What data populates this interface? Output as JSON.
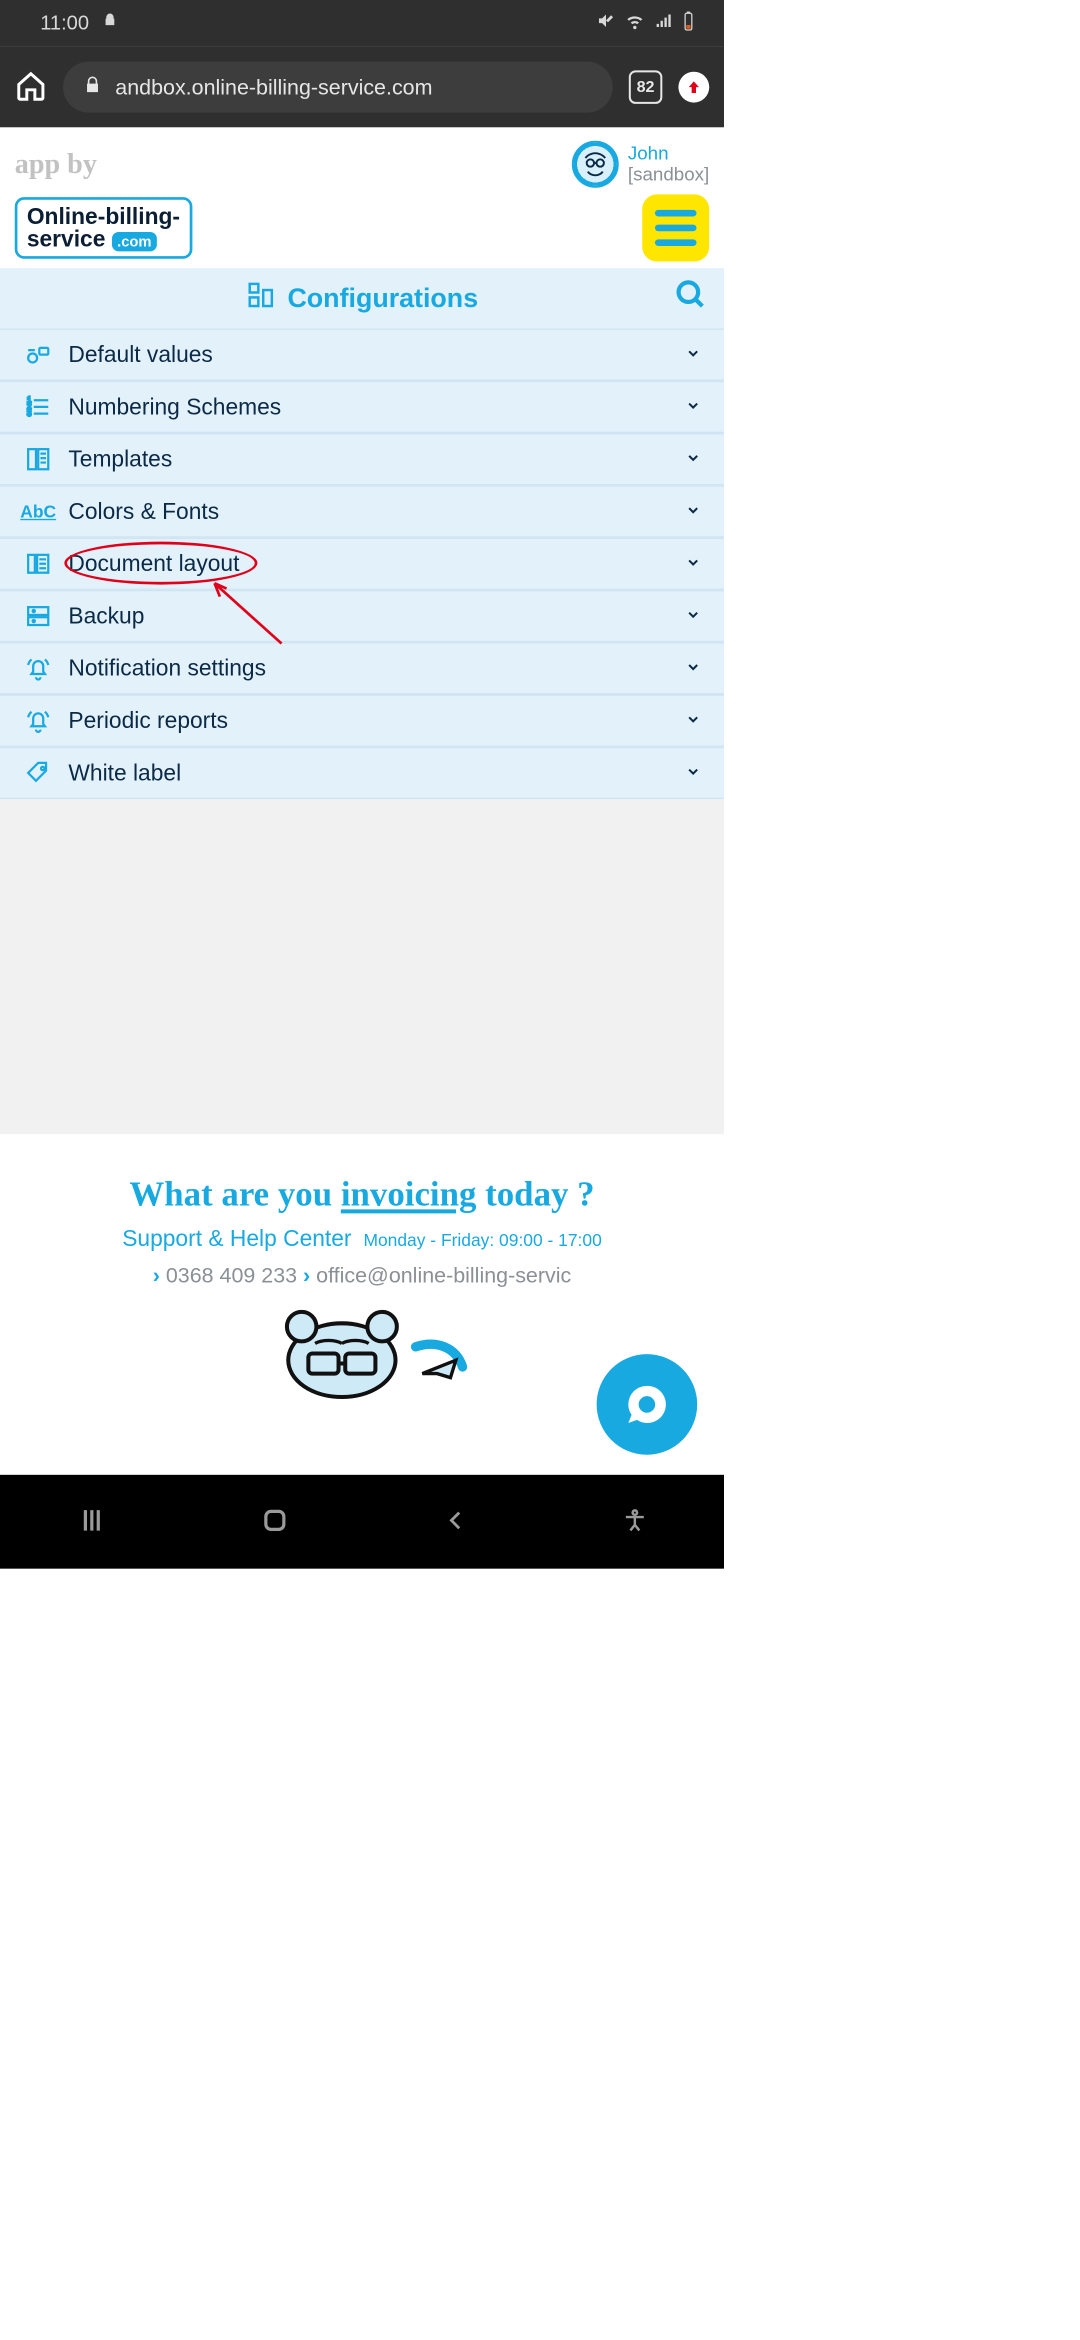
{
  "status": {
    "time": "11:00",
    "tab_count": "82"
  },
  "browser": {
    "url": "andbox.online-billing-service.com"
  },
  "header": {
    "app_by": "app by",
    "logo_line1": "Online-billing-",
    "logo_line2": "service",
    "logo_suffix": ".com",
    "user_name": "John",
    "user_env": "[sandbox]"
  },
  "section": {
    "title": "Configurations"
  },
  "menu": [
    {
      "label": "Default values"
    },
    {
      "label": "Numbering Schemes"
    },
    {
      "label": "Templates"
    },
    {
      "label": "Colors & Fonts"
    },
    {
      "label": "Document layout"
    },
    {
      "label": "Backup"
    },
    {
      "label": "Notification settings"
    },
    {
      "label": "Periodic reports"
    },
    {
      "label": "White label"
    }
  ],
  "footer": {
    "tagline_pre": "What are you ",
    "tagline_em": "invoicing",
    "tagline_post": " today ?",
    "support": "Support & Help Center",
    "hours": "Monday - Friday: 09:00 - 17:00",
    "phone": "0368 409 233",
    "email": "office@online-billing-servic"
  }
}
